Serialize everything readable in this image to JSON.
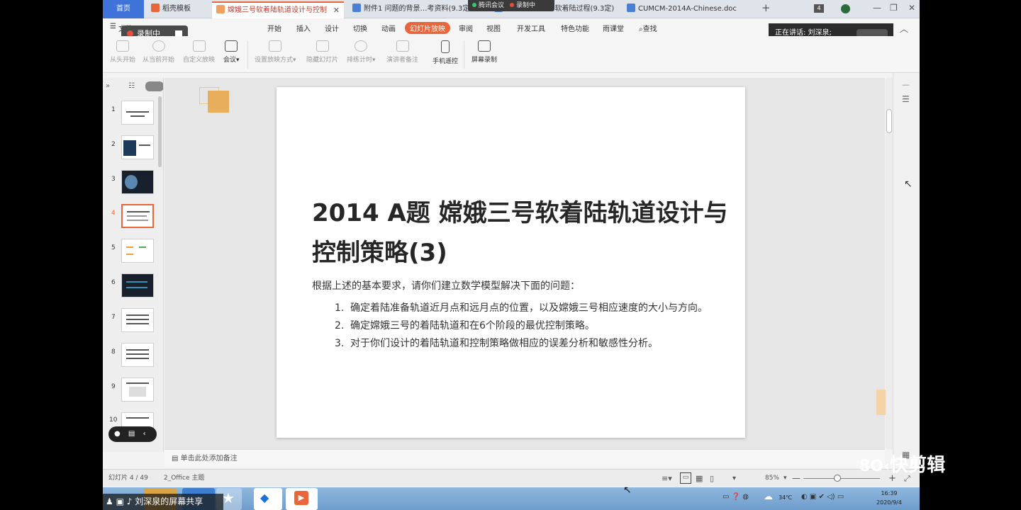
{
  "tabs": {
    "home": "首页",
    "template": "稻壳模板",
    "active": "嫦娥三号软着陆轨道设计与控制",
    "doc1": "附件1 问题的背景…考资料(9.3定)",
    "doc2": "附件2 嫦娥三号软着陆过程(9.3定)",
    "doc3": "CUMCM-2014A-Chinese.doc",
    "tab_count": "4"
  },
  "meeting_bar": {
    "meeting": "腾讯会议",
    "recording": "录制中"
  },
  "recording_badge": {
    "label": "录制中"
  },
  "speaking": {
    "label": "正在讲话: 刘深泉;"
  },
  "menu": {
    "file": "文件",
    "items": [
      "开始",
      "插入",
      "设计",
      "切换",
      "动画",
      "幻灯片放映",
      "审阅",
      "视图",
      "开发工具",
      "特色功能",
      "雨课堂"
    ],
    "search": "查找"
  },
  "toolbar": [
    "从头开始",
    "从当前开始",
    "自定义放映",
    "会议",
    "设置放映方式",
    "隐藏幻灯片",
    "排练计时",
    "演讲者备注",
    "手机遥控",
    "屏幕录制"
  ],
  "thumbnails": [
    "1",
    "2",
    "3",
    "4",
    "5",
    "6",
    "7",
    "8",
    "9",
    "10"
  ],
  "slide": {
    "title": "2014 A题 嫦娥三号软着陆轨道设计与控制策略(3)",
    "intro": "根据上述的基本要求，请你们建立数学模型解决下面的问题：",
    "items": [
      {
        "num": "1.",
        "text": "确定着陆准备轨道近月点和远月点的位置，以及嫦娥三号相应速度的大小与方向。"
      },
      {
        "num": "2.",
        "text": "确定嫦娥三号的着陆轨道和在6个阶段的最优控制策略。"
      },
      {
        "num": "3.",
        "text": "对于你们设计的着陆轨道和控制策略做相应的误差分析和敏感性分析。"
      }
    ]
  },
  "notes_placeholder": "单击此处添加备注",
  "status": {
    "slide_info": "幻灯片 4 / 49",
    "theme": "2_Office 主题",
    "zoom": "85%",
    "zoom_fraction": 0.44
  },
  "taskbar": {
    "temperature": "34℃",
    "time": "16:39",
    "date": "2020/9/4"
  },
  "share_label": "刘深泉的屏幕共享",
  "watermark": "快剪辑"
}
